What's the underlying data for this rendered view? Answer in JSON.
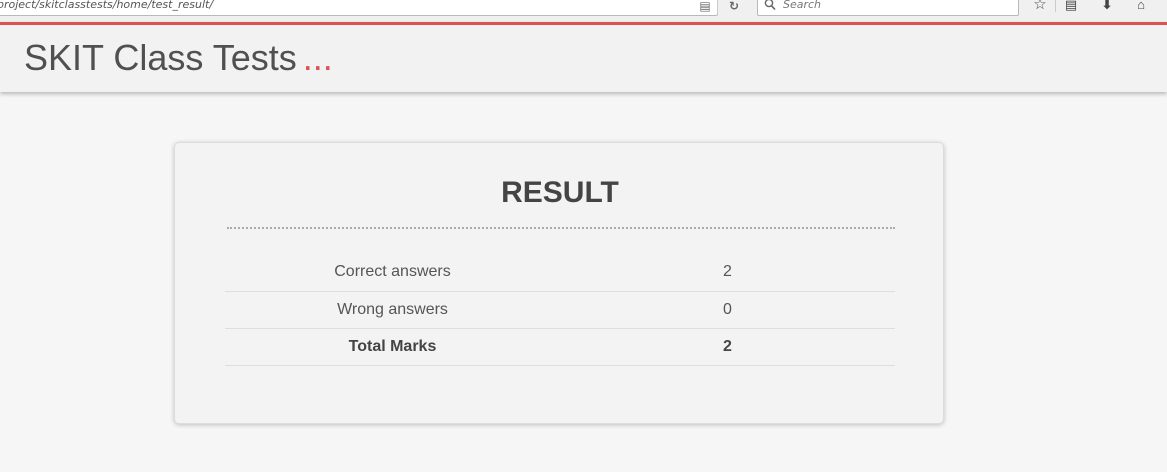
{
  "browser": {
    "url": "project/skitclasstests/home/test_result/",
    "search_placeholder": "Search",
    "icons": [
      "reader-icon",
      "reload-icon",
      "search-icon",
      "star-icon",
      "library-icon",
      "download-icon",
      "home-icon"
    ]
  },
  "header": {
    "title": "SKIT Class Tests",
    "dots": "...",
    "accent_color": "#d9534f"
  },
  "result": {
    "title": "RESULT",
    "rows": [
      {
        "label": "Correct answers",
        "value": "2"
      },
      {
        "label": "Wrong answers",
        "value": "0"
      },
      {
        "label": "Total Marks",
        "value": "2"
      }
    ]
  }
}
